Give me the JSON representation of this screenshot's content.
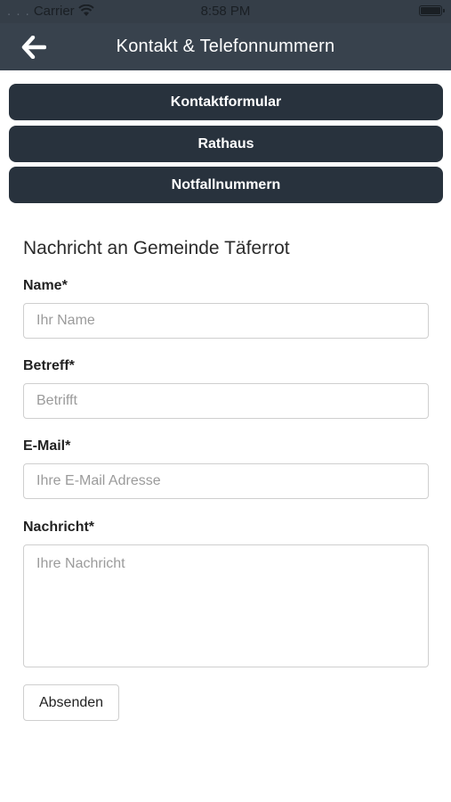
{
  "status_bar": {
    "carrier": "Carrier",
    "time": "8:58 PM"
  },
  "nav": {
    "title": "Kontakt & Telefonnummern",
    "back_icon": "arrow-left-icon"
  },
  "tabs": [
    {
      "label": "Kontaktformular"
    },
    {
      "label": "Rathaus"
    },
    {
      "label": "Notfallnummern"
    }
  ],
  "form": {
    "title": "Nachricht an Gemeinde Täferrot",
    "fields": [
      {
        "label": "Name*",
        "placeholder": "Ihr Name",
        "value": ""
      },
      {
        "label": "Betreff*",
        "placeholder": "Betrifft",
        "value": ""
      },
      {
        "label": "E-Mail*",
        "placeholder": "Ihre E-Mail Adresse",
        "value": ""
      },
      {
        "label": "Nachricht*",
        "placeholder": "Ihre Nachricht",
        "value": ""
      }
    ],
    "submit_label": "Absenden"
  },
  "colors": {
    "nav_background": "#38424d",
    "tab_background": "#28323d",
    "tab_text": "#ffffff"
  }
}
